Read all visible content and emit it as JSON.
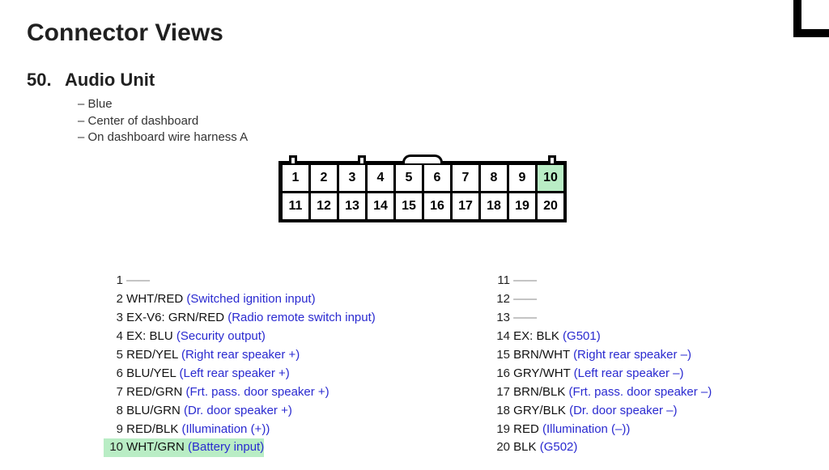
{
  "page_title": "Connector Views",
  "section_no": "50.",
  "section_title": "Audio Unit",
  "desc": [
    "– Blue",
    "– Center of dashboard",
    "– On dashboard wire harness A"
  ],
  "highlight_pins": [
    10
  ],
  "pin_grid": {
    "rows": [
      [
        1,
        2,
        3,
        4,
        5,
        6,
        7,
        8,
        9,
        10
      ],
      [
        11,
        12,
        13,
        14,
        15,
        16,
        17,
        18,
        19,
        20
      ]
    ]
  },
  "pinout_left": [
    {
      "n": 1,
      "wire": "",
      "func": "",
      "empty": true
    },
    {
      "n": 2,
      "wire": "WHT/RED",
      "func": "(Switched ignition input)"
    },
    {
      "n": 3,
      "wire": "EX-V6: GRN/RED",
      "func": "(Radio remote switch input)"
    },
    {
      "n": 4,
      "wire": "EX: BLU",
      "func": "(Security output)"
    },
    {
      "n": 5,
      "wire": "RED/YEL",
      "func": "(Right rear speaker +)"
    },
    {
      "n": 6,
      "wire": "BLU/YEL",
      "func": "(Left rear speaker +)"
    },
    {
      "n": 7,
      "wire": "RED/GRN",
      "func": "(Frt. pass. door speaker +)"
    },
    {
      "n": 8,
      "wire": "BLU/GRN",
      "func": "(Dr. door speaker +)"
    },
    {
      "n": 9,
      "wire": "RED/BLK",
      "func": "(Illumination (+))"
    },
    {
      "n": 10,
      "wire": "WHT/GRN",
      "func": "(Battery input)",
      "hl": true
    }
  ],
  "pinout_right": [
    {
      "n": 11,
      "wire": "",
      "func": "",
      "empty": true
    },
    {
      "n": 12,
      "wire": "",
      "func": "",
      "empty": true
    },
    {
      "n": 13,
      "wire": "",
      "func": "",
      "empty": true
    },
    {
      "n": 14,
      "wire": "EX: BLK",
      "func": "(G501)"
    },
    {
      "n": 15,
      "wire": "BRN/WHT",
      "func": "(Right rear speaker –)"
    },
    {
      "n": 16,
      "wire": "GRY/WHT",
      "func": "(Left rear speaker –)"
    },
    {
      "n": 17,
      "wire": "BRN/BLK",
      "func": "(Frt. pass. door speaker –)"
    },
    {
      "n": 18,
      "wire": "GRY/BLK",
      "func": "(Dr. door speaker –)"
    },
    {
      "n": 19,
      "wire": "RED",
      "func": "(Illumination (–))"
    },
    {
      "n": 20,
      "wire": "BLK",
      "func": "(G502)"
    }
  ]
}
